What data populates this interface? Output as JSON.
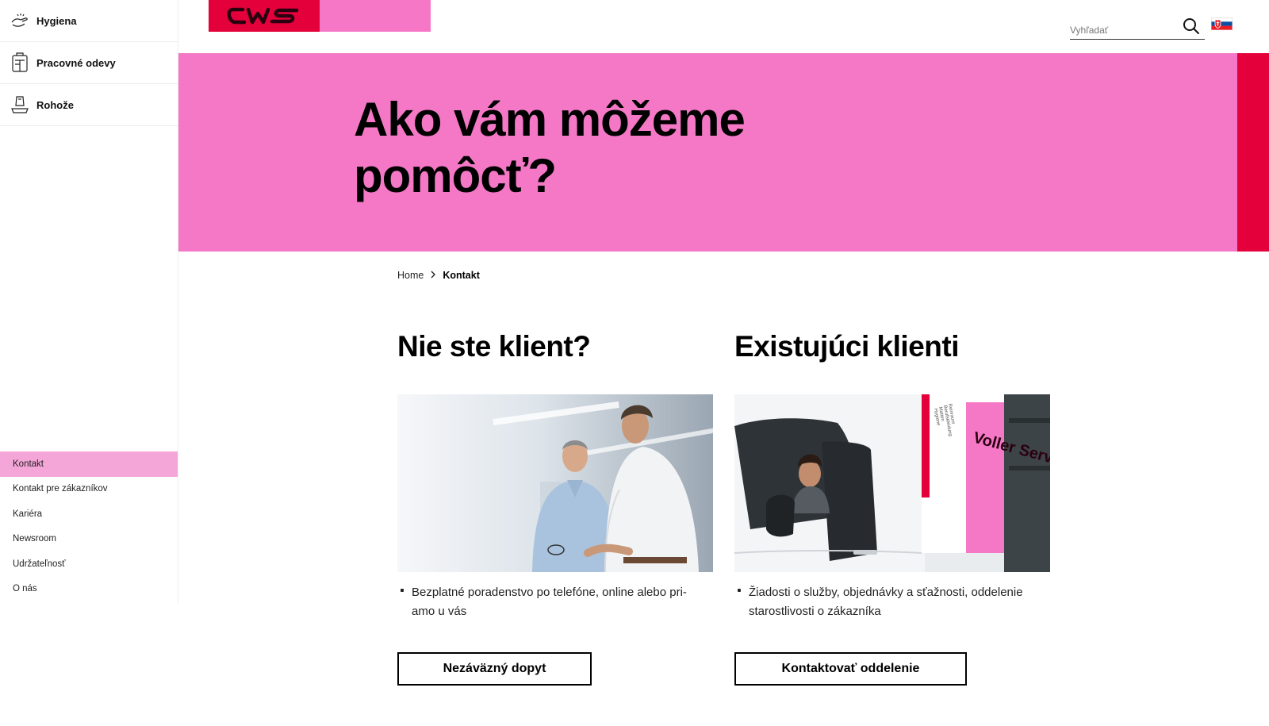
{
  "brand": {
    "logo_text": "CWS",
    "accent": "#e4003b",
    "pink": "#f478c6"
  },
  "sidebar": {
    "categories": [
      {
        "label": "Hygiena",
        "icon": "hands-washing-icon"
      },
      {
        "label": "Pracovné odevy",
        "icon": "workwear-icon"
      },
      {
        "label": "Rohože",
        "icon": "mat-icon"
      }
    ],
    "nav": [
      {
        "label": "Kontakt",
        "active": true
      },
      {
        "label": "Kontakt pre zákazníkov"
      },
      {
        "label": "Kariéra"
      },
      {
        "label": "Newsroom"
      },
      {
        "label": "Udržateľnosť"
      },
      {
        "label": "O nás"
      }
    ]
  },
  "header": {
    "search": {
      "placeholder": "Vyhľadať",
      "icon": "search-icon"
    },
    "language_flag": "slovak-flag-icon"
  },
  "hero": {
    "title": "Ako vám môžeme pomôcť?"
  },
  "breadcrumb": {
    "home": "Home",
    "current": "Kontakt"
  },
  "columns": [
    {
      "title": "Nie ste klient?",
      "bullet": "Bezplatné poradenstvo po telefóne, online alebo pri­amo u vás",
      "button": "Nezáväzný dopyt"
    },
    {
      "title": "Existujúci klienti",
      "bullet": "Žiadosti o služby, objednávky a sťažnosti, oddelenie starostlivosti o zákazníka",
      "button": "Kontaktovať oddelenie",
      "van_text": "Voller Service"
    }
  ]
}
